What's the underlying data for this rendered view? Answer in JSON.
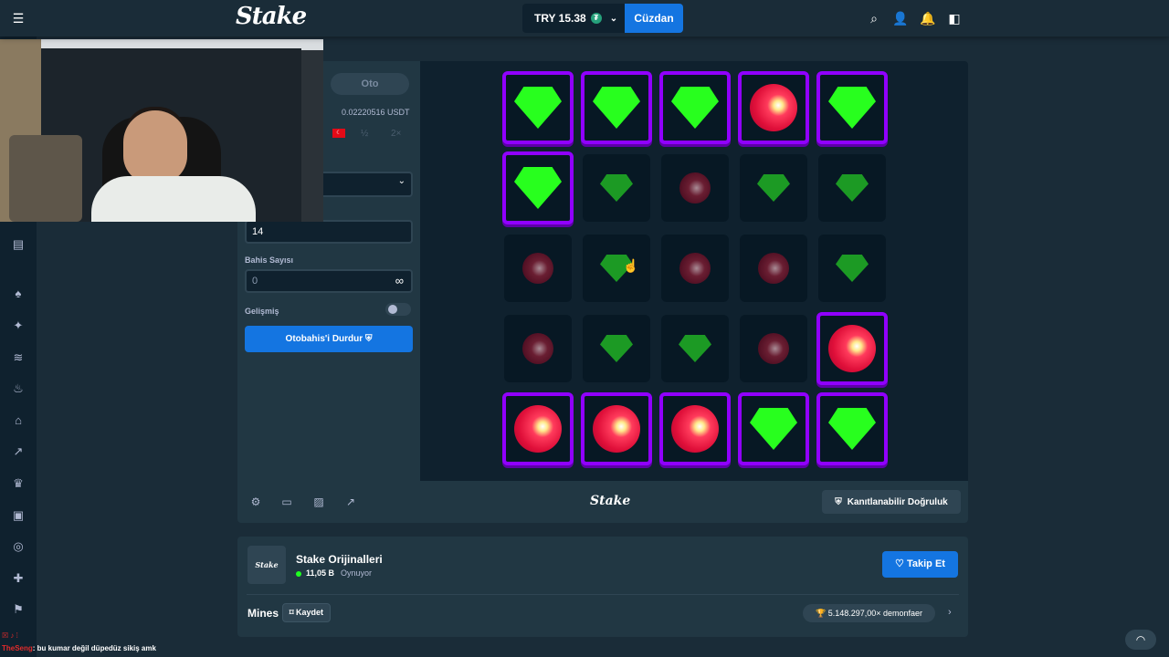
{
  "header": {
    "menu_icon": "hamburger-icon",
    "logo": "Stake",
    "balance": "TRY 15.38",
    "currency_icon": "tether-icon",
    "wallet_label": "Cüzdan",
    "icons": [
      "search-icon",
      "user-icon",
      "bell-icon",
      "panel-icon"
    ]
  },
  "sidebar": {
    "icons": [
      "news-icon",
      "casino-icon",
      "sparkle-icon",
      "racing-icon",
      "fire-icon",
      "sweater-icon",
      "rocket-icon",
      "crown-icon",
      "jar-icon",
      "target-icon",
      "gift-icon",
      "brand-icon"
    ]
  },
  "bet_panel": {
    "tab_auto": "Oto",
    "usdt_amount": "0.02220516 USDT",
    "half_label": "½",
    "double_label": "2×",
    "mines_value": "14",
    "bet_count_label": "Bahis Sayısı",
    "bet_count_value": "0",
    "advanced_label": "Gelişmiş",
    "advanced_enabled": false,
    "stop_button": "Otobahis'i Durdur"
  },
  "grid": {
    "rows": 5,
    "cols": 5,
    "tiles": [
      [
        "gem-revealed",
        "gem-revealed",
        "gem-revealed",
        "mine-revealed",
        "gem-revealed"
      ],
      [
        "gem-revealed",
        "gem",
        "mine",
        "gem",
        "gem"
      ],
      [
        "mine",
        "gem",
        "mine",
        "mine",
        "gem"
      ],
      [
        "mine",
        "gem",
        "gem",
        "mine",
        "mine-revealed"
      ],
      [
        "mine-revealed",
        "mine-revealed",
        "mine-revealed",
        "gem-revealed",
        "gem-revealed"
      ]
    ]
  },
  "toolbar": {
    "icons": [
      "settings-icon",
      "theatre-icon",
      "stats-icon",
      "trend-icon"
    ],
    "logo": "Stake",
    "fair_label": "Kanıtlanabilir Doğruluk"
  },
  "info": {
    "title": "Stake Orijinalleri",
    "players": "11,05 B",
    "playing_label": "Oynuyor",
    "follow_label": "Takip Et",
    "game_name": "Mines",
    "save_label": "Kaydet",
    "record": "5.148.297,00× demonfaer"
  },
  "chat": {
    "user": "TheSeng",
    "message": ": bu kumar değil düpedüz sikiş amk"
  },
  "colors": {
    "accent": "#1475e1",
    "revealed_border": "#9000ff",
    "gem": "#28ff1e",
    "mine": "#e0103a"
  }
}
